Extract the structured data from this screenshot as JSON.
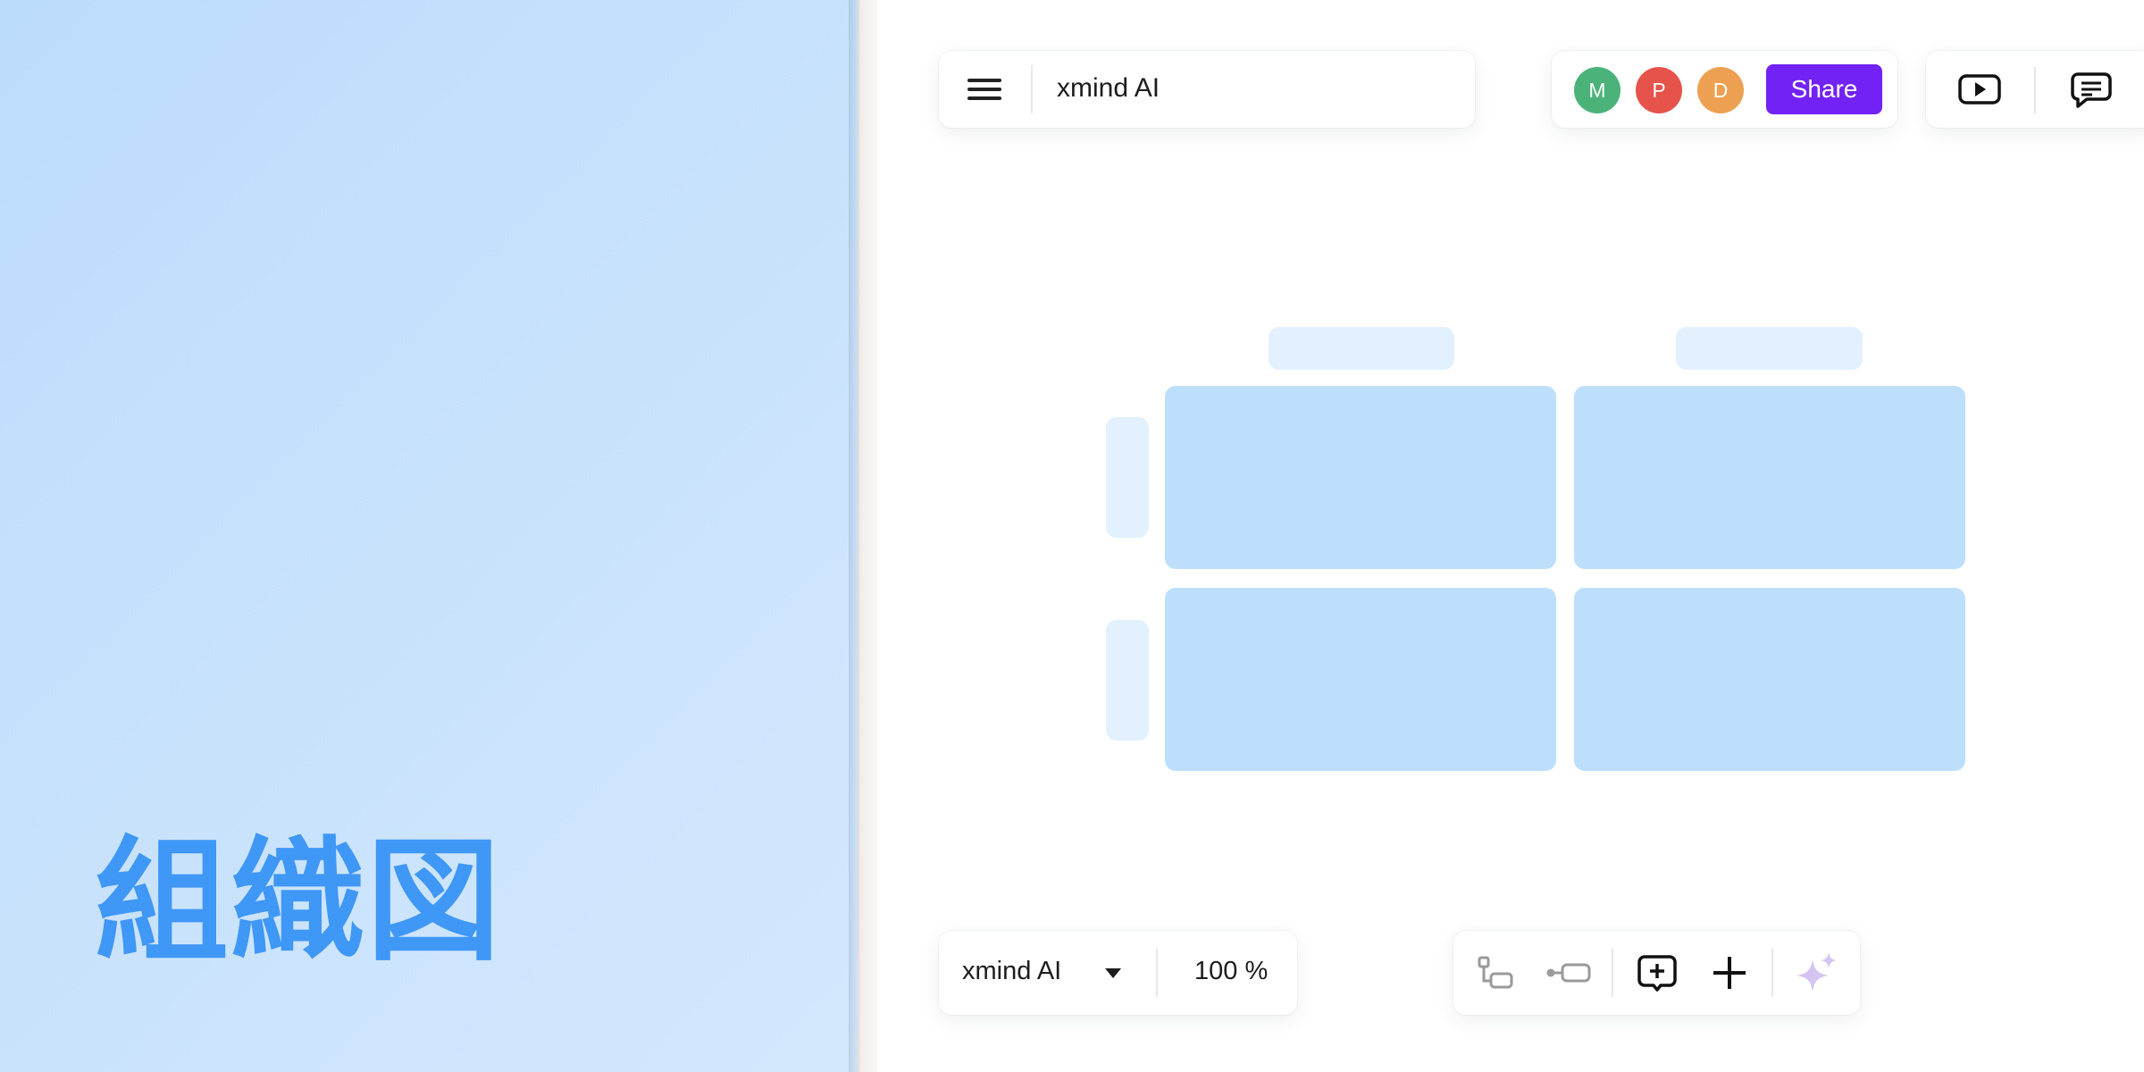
{
  "promo": {
    "title": "組織図"
  },
  "header": {
    "document_title": "xmind AI",
    "share_label": "Share"
  },
  "collaborators": [
    {
      "initial": "M",
      "color": "#4bb37a"
    },
    {
      "initial": "P",
      "color": "#e5534b"
    },
    {
      "initial": "D",
      "color": "#eea052"
    }
  ],
  "toolbar_right": {
    "icons": [
      "play-presentation-icon",
      "comment-icon"
    ]
  },
  "footer": {
    "style_label": "xmind AI",
    "zoom": "100 %",
    "tools": [
      "subtopic-icon",
      "floating-topic-icon",
      "insert-topic-icon",
      "add-icon",
      "ai-sparkle-icon"
    ]
  },
  "colors": {
    "accent": "#7222f5",
    "promo_text": "#3f97f6",
    "block_fill": "#bedffc",
    "header_fill": "#e3f0fd",
    "sparkle": "#d4c4f2"
  }
}
